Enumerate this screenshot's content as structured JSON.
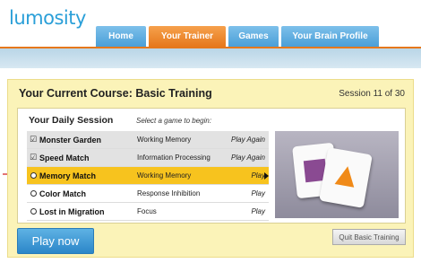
{
  "header": {
    "logo": "lumosity",
    "tabs": [
      {
        "label": "Home",
        "active": false
      },
      {
        "label": "Your Trainer",
        "active": true
      },
      {
        "label": "Games",
        "active": false
      },
      {
        "label": "Your Brain Profile",
        "active": false
      }
    ]
  },
  "course": {
    "title": "Your Current Course: Basic Training",
    "session": "Session 11 of 30",
    "daily_title": "Your Daily Session",
    "daily_hint": "Select a game to begin:",
    "games": [
      {
        "name": "Monster Garden",
        "area": "Working Memory",
        "action": "Play Again",
        "state": "done"
      },
      {
        "name": "Speed Match",
        "area": "Information Processing",
        "action": "Play Again",
        "state": "done"
      },
      {
        "name": "Memory Match",
        "area": "Working Memory",
        "action": "Play",
        "state": "current"
      },
      {
        "name": "Color Match",
        "area": "Response Inhibition",
        "action": "Play",
        "state": "todo"
      },
      {
        "name": "Lost in Migration",
        "area": "Focus",
        "action": "Play",
        "state": "todo"
      }
    ],
    "play_label": "Play now",
    "quit_label": "Quit Basic Training"
  },
  "colors": {
    "accent_orange": "#e6781c",
    "brand_blue": "#2a9fd8",
    "highlight": "#f7c31e",
    "panel": "#fbf3b8"
  },
  "icons": {
    "done": "check-radio-icon",
    "todo": "radio-icon",
    "selected": "play-arrow-icon",
    "pointer": "red-arrow-icon"
  }
}
